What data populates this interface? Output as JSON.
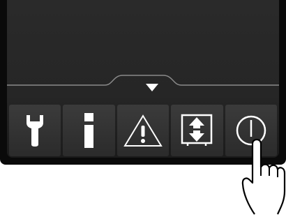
{
  "screen": {
    "expand_control": {
      "icon": "triangle-down-icon"
    },
    "toolbar": {
      "buttons": [
        {
          "id": "service",
          "icon": "wrench-icon"
        },
        {
          "id": "info",
          "icon": "info-icon"
        },
        {
          "id": "alarm",
          "icon": "warning-triangle-icon"
        },
        {
          "id": "level",
          "icon": "up-down-arrows-icon"
        },
        {
          "id": "power",
          "icon": "power-icon"
        }
      ]
    }
  },
  "overlay": {
    "pointer": "pointing-hand-icon",
    "pressed_button": "power"
  },
  "colors": {
    "bezel": "#0a0a0a",
    "screen": "#262626",
    "button": "#333333",
    "glyph": "#ffffff"
  }
}
